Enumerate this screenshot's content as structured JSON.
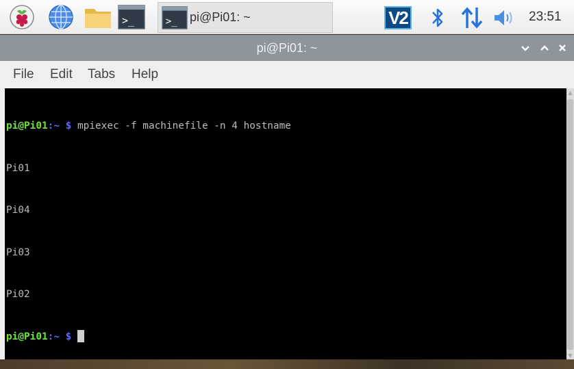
{
  "taskbar": {
    "launchers": [
      {
        "name": "raspberry-menu",
        "icon": "raspberry-pi-icon"
      },
      {
        "name": "web-browser",
        "icon": "globe-icon"
      },
      {
        "name": "file-manager",
        "icon": "folder-icon"
      },
      {
        "name": "terminal",
        "icon": "terminal-icon"
      }
    ],
    "task_button_label": "pi@Pi01: ~",
    "vnc_label": "V2",
    "clock": "23:51"
  },
  "window": {
    "title": "pi@Pi01: ~"
  },
  "menu": {
    "file": "File",
    "edit": "Edit",
    "tabs": "Tabs",
    "help": "Help"
  },
  "terminal": {
    "prompt_user": "pi@Pi01",
    "prompt_path": ":~",
    "prompt_symbol": "$",
    "command": "mpiexec -f machinefile -n 4 hostname",
    "output": [
      "Pi01",
      "Pi04",
      "Pi03",
      "Pi02"
    ]
  },
  "colors": {
    "prompt_user": "#6ee33a",
    "prompt_path": "#5b6bff",
    "terminal_bg": "#000000",
    "titlebar": "#8e959c"
  }
}
